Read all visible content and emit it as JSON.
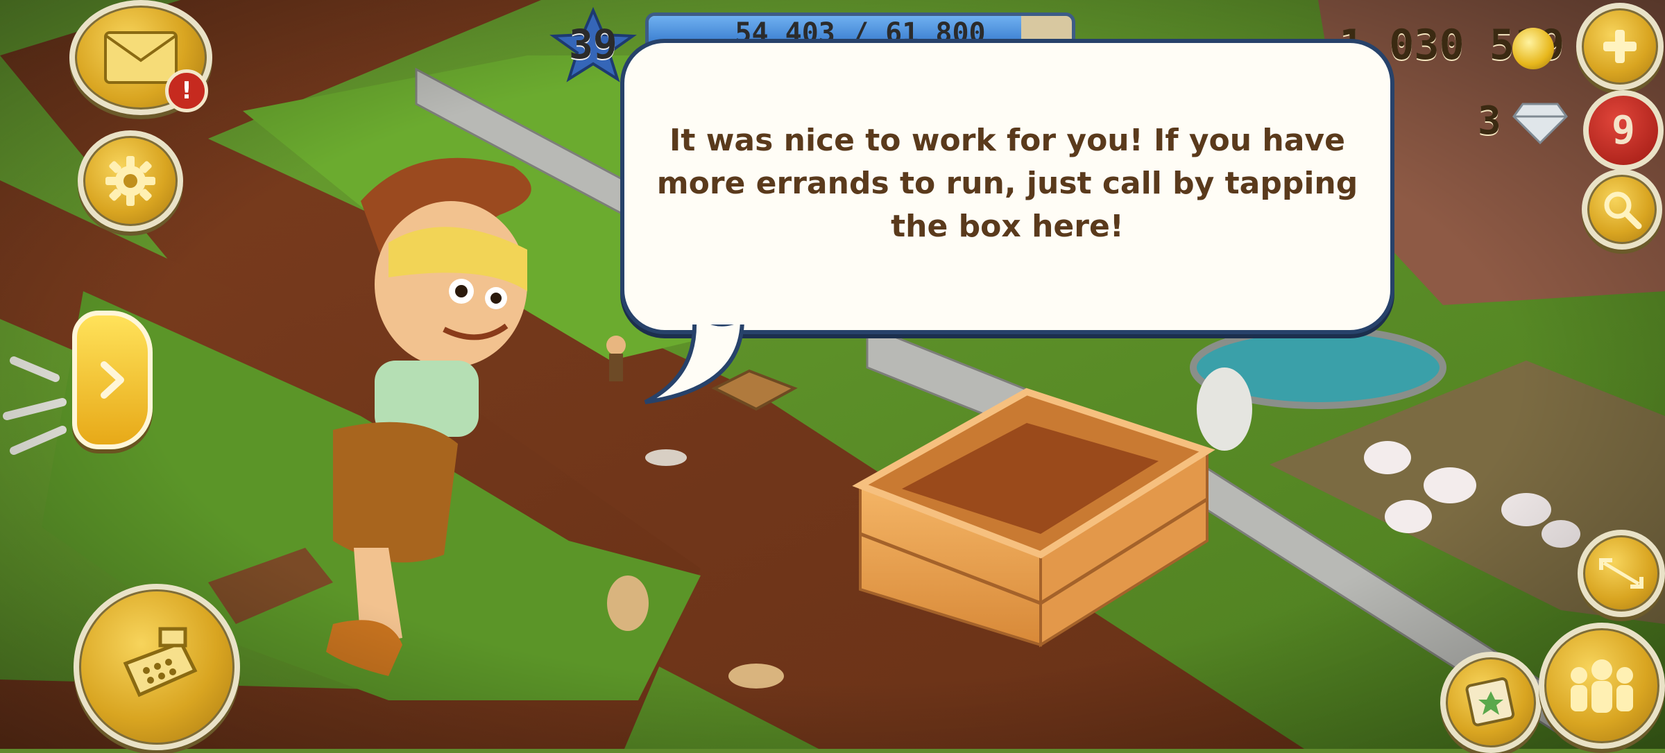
{
  "hud": {
    "level": "39",
    "xp_progress": "54 403 / 61 800",
    "xp_fraction": 0.88,
    "coins": "1 030 519",
    "diamonds": "3",
    "notification_count": "9",
    "mail_alert": "!"
  },
  "dialog": {
    "message": "It was nice to work for you! If you have more errands to run, just call by tapping the box here!"
  },
  "icons": {
    "mail": "envelope-icon",
    "settings": "gear-icon",
    "next": "chevron-right-icon",
    "shop": "cash-register-icon",
    "add_coins": "plus-icon",
    "search": "magnifier-icon",
    "expand": "expand-icon",
    "friends": "people-icon",
    "map": "map-card-icon"
  },
  "colors": {
    "accent_gold": "#e1ad24",
    "badge_red": "#c62a1f",
    "bubble_border": "#27426a",
    "text_brown": "#5a3a1c"
  }
}
